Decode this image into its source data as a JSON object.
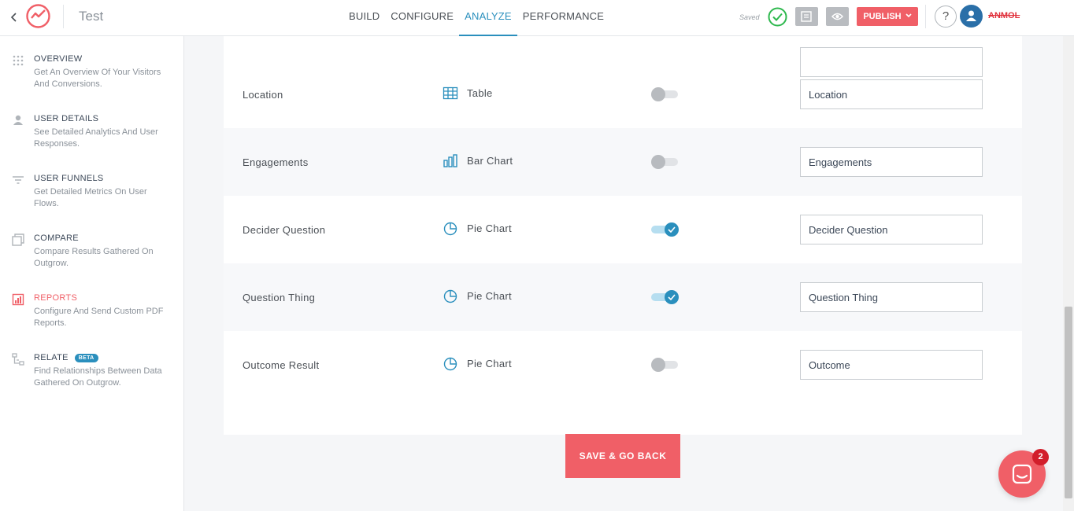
{
  "header": {
    "title": "Test",
    "nav_tabs": [
      {
        "label": "BUILD"
      },
      {
        "label": "CONFIGURE"
      },
      {
        "label": "ANALYZE"
      },
      {
        "label": "PERFORMANCE"
      }
    ],
    "active_tab": "ANALYZE",
    "saved_label": "Saved",
    "publish_label": "PUBLISH",
    "help_label": "?",
    "username": "ANMOL"
  },
  "sidebar": {
    "items": [
      {
        "title": "OVERVIEW",
        "desc": "Get An Overview Of Your Visitors And Conversions.",
        "icon": "grid-dots-icon"
      },
      {
        "title": "USER DETAILS",
        "desc": "See Detailed Analytics And User Responses.",
        "icon": "user-icon"
      },
      {
        "title": "USER FUNNELS",
        "desc": "Get Detailed Metrics On User Flows.",
        "icon": "filter-icon"
      },
      {
        "title": "COMPARE",
        "desc": "Compare Results Gathered On Outgrow.",
        "icon": "compare-icon"
      },
      {
        "title": "REPORTS",
        "desc": "Configure And Send Custom PDF Reports.",
        "icon": "report-icon"
      },
      {
        "title": "RELATE",
        "badge": "BETA",
        "desc": "Find Relationships Between Data Gathered On Outgrow.",
        "icon": "relate-icon"
      }
    ],
    "active_item": "REPORTS"
  },
  "rows": [
    {
      "label": "Location",
      "chart_type": "Table",
      "icon": "table-icon",
      "enabled": false,
      "input_value": "Location"
    },
    {
      "label": "Engagements",
      "chart_type": "Bar Chart",
      "icon": "bar-chart-icon",
      "enabled": false,
      "input_value": "Engagements"
    },
    {
      "label": "Decider Question",
      "chart_type": "Pie Chart",
      "icon": "pie-chart-icon",
      "enabled": true,
      "input_value": "Decider Question"
    },
    {
      "label": "Question Thing",
      "chart_type": "Pie Chart",
      "icon": "pie-chart-icon",
      "enabled": true,
      "input_value": "Question Thing"
    },
    {
      "label": "Outcome Result",
      "chart_type": "Pie Chart",
      "icon": "pie-chart-icon",
      "enabled": false,
      "input_value": "Outcome"
    }
  ],
  "save_button_label": "SAVE & GO BACK",
  "chat_badge_count": "2",
  "colors": {
    "accent": "#2a8fbd",
    "brand": "#f05f67",
    "success": "#2db84d"
  }
}
